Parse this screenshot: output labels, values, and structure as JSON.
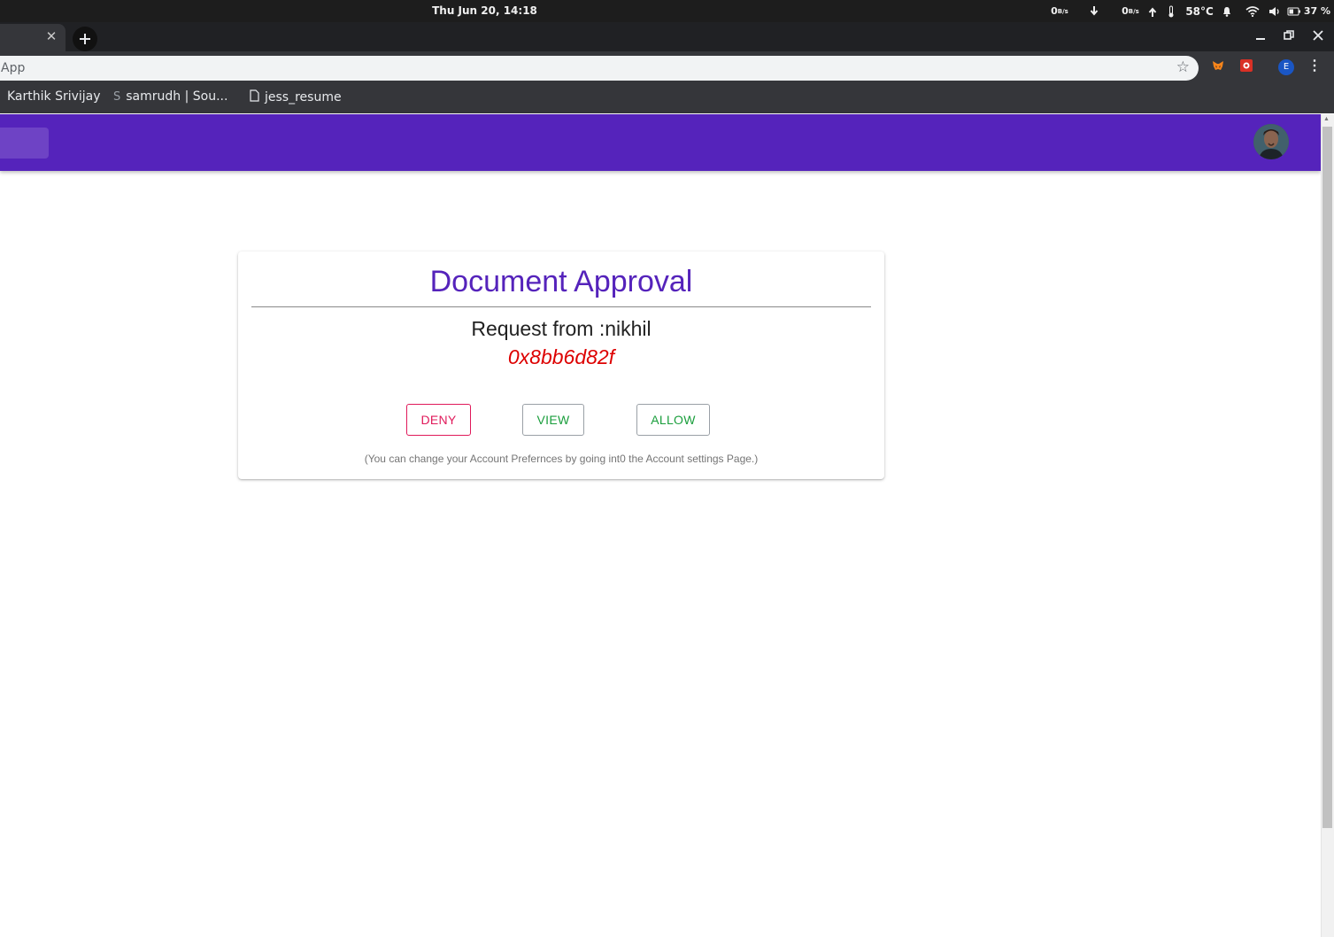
{
  "system_bar": {
    "clock": "Thu Jun 20, 14:18",
    "net_down": "0",
    "net_down_unit": "B/s",
    "net_up": "0",
    "net_up_unit": "B/s",
    "temperature": "58°C",
    "battery": "37 %"
  },
  "browser": {
    "url_text": "App",
    "profile_initial": "E",
    "bookmarks": [
      "Karthik Srivijay",
      "samrudh | Sou...",
      "jess_resume"
    ]
  },
  "card": {
    "title": "Document Approval",
    "request_text": "Request from :nikhil",
    "hash": "0x8bb6d82f",
    "deny_label": "DENY",
    "view_label": "VIEW",
    "allow_label": "ALLOW",
    "note": "(You can change your Account Prefernces by going int0 the Account settings Page.)"
  },
  "colors": {
    "app_bar": "#5523bb",
    "title": "#5523bb",
    "hash": "#dd0000",
    "deny": "#e0195a",
    "allow": "#1a9e3c"
  }
}
